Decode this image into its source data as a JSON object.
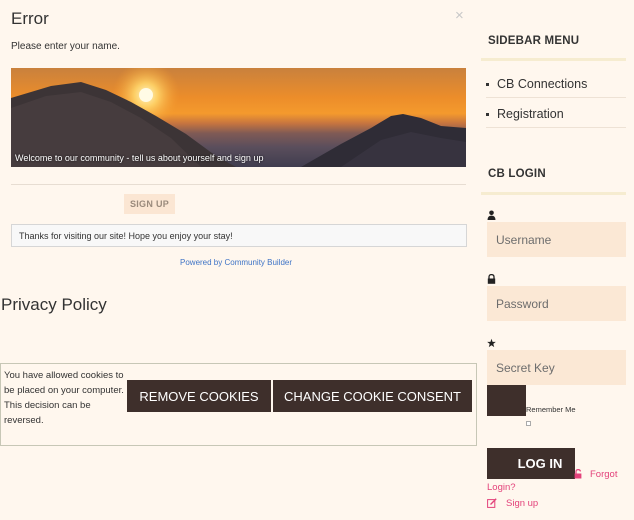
{
  "modal": {
    "title": "Error",
    "close_symbol": "×",
    "message": "Please enter your name.",
    "banner_caption": "Welcome to our community - tell us about yourself and sign up",
    "signup_label": "SIGN UP",
    "welcome_text": "Thanks for visiting our site! Hope you enjoy your stay!",
    "powered_by": "Powered by Community Builder"
  },
  "privacy": {
    "title": "Privacy Policy"
  },
  "cookies": {
    "notice": "You have allowed cookies to be placed on your computer. This decision can be reversed.",
    "remove_label": "REMOVE COOKIES",
    "change_label": "CHANGE COOKIE CONSENT"
  },
  "sidebar": {
    "menu_title": "SIDEBAR MENU",
    "items": [
      {
        "label": "CB Connections"
      },
      {
        "label": "Registration"
      }
    ]
  },
  "login": {
    "title": "CB LOGIN",
    "username_placeholder": "Username",
    "password_placeholder": "Password",
    "secret_key_placeholder": "Secret Key",
    "remember_label": "Remember Me",
    "login_label": "LOG IN",
    "forgot_part1": "Forgot",
    "forgot_part2": "Login?",
    "signup_label": "Sign up"
  },
  "icons": {
    "username": "user-icon",
    "password": "lock-icon",
    "secret_key": "star-icon",
    "forgot": "unlock-icon",
    "signup": "edit-icon"
  },
  "colors": {
    "background": "#fff7ee",
    "button_dark": "#3e2f2b",
    "input_bg": "#fbe8d5",
    "link_pink": "#e3427a",
    "link_blue": "#3f74c6"
  }
}
